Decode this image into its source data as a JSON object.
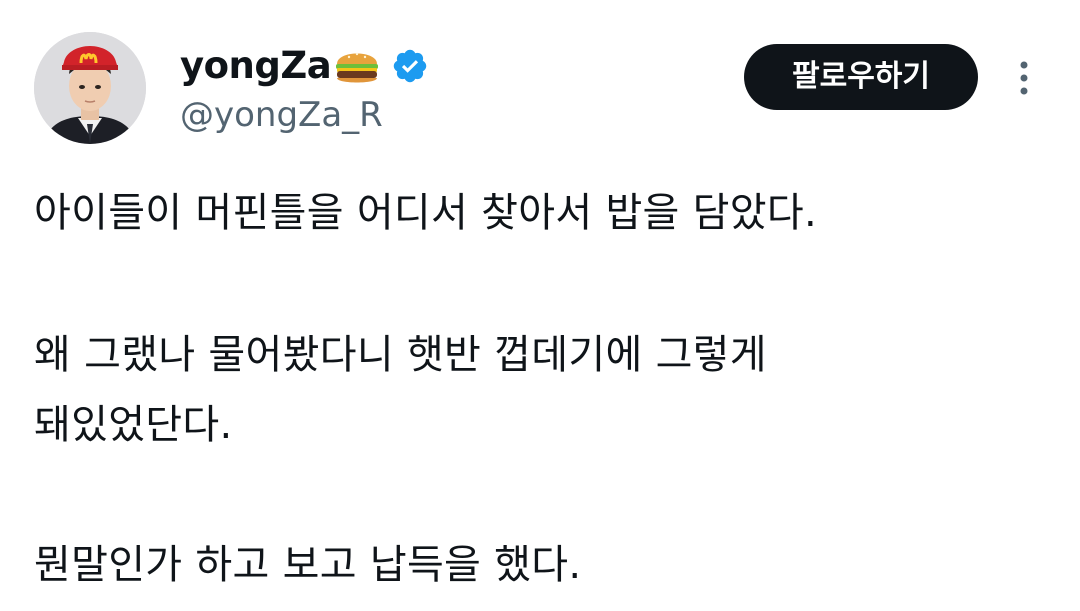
{
  "author": {
    "display_name": "yongZa",
    "name_emoji": "hamburger-emoji",
    "verified_icon": "verified-badge-icon",
    "handle": "@yongZa_R",
    "avatar": "profile-photo"
  },
  "actions": {
    "follow_label": "팔로우하기",
    "more_icon": "more-vertical-icon"
  },
  "tweet": {
    "lines": [
      "아이들이 머핀틀을 어디서 찾아서 밥을 담았다.",
      "왜 그랬나 물어봤다니 햇반 껍데기에 그렇게",
      "돼있었단다.",
      "뭔말인가 하고 보고 납득을 했다."
    ]
  },
  "colors": {
    "text": "#0f1419",
    "secondary_text": "#536471",
    "verified_blue": "#1d9bf0",
    "button_bg": "#0f1419"
  }
}
